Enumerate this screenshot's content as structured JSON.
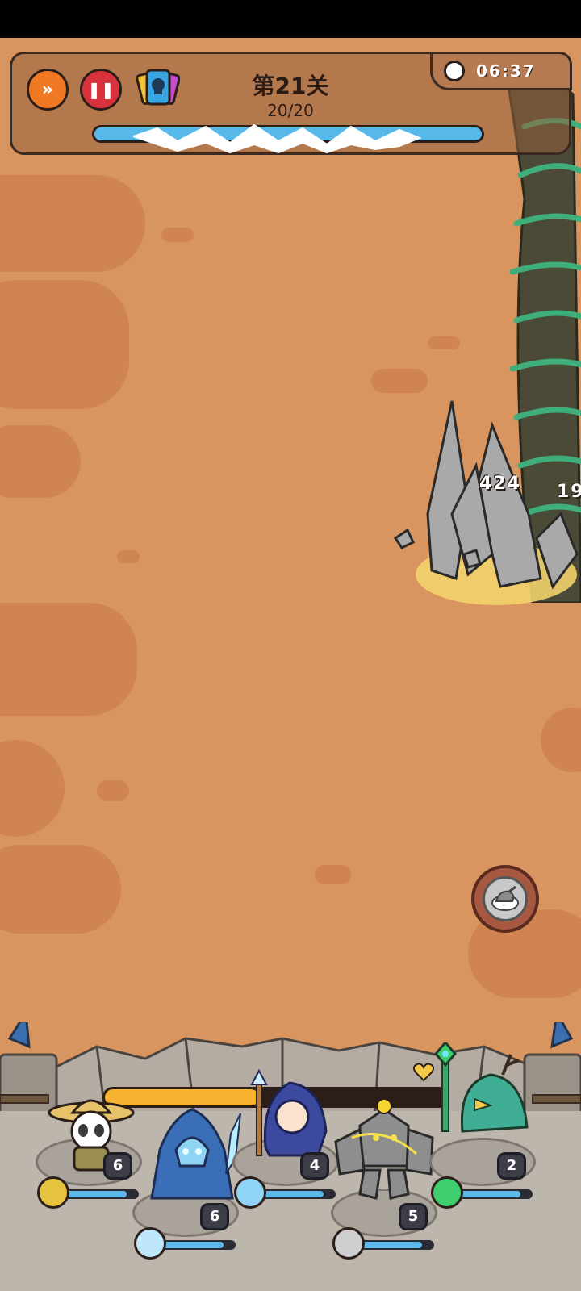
{
  "hud": {
    "level_title": "第21关",
    "wave_count": "20/20",
    "wave_progress_fraction": 1.0,
    "timer": "06:37",
    "buttons": {
      "fast_forward_icon": "double-chevron-right-icon",
      "pause_icon": "pause-icon",
      "cards_icon": "skull-card-icon"
    }
  },
  "battlefield": {
    "damage_numbers": [
      "424",
      "19"
    ],
    "skill_button_icon": "roast-meat-icon"
  },
  "base": {
    "energy_fraction": 0.45,
    "heroes": [
      {
        "name": "panda-ranger",
        "level": "6",
        "element": "lightning",
        "hp_fraction": 0.85
      },
      {
        "name": "ice-knight",
        "level": "6",
        "element": "ice",
        "hp_fraction": 0.85
      },
      {
        "name": "ice-mage",
        "level": "4",
        "element": "ice",
        "hp_fraction": 0.85
      },
      {
        "name": "stone-golem",
        "level": "5",
        "element": "rock",
        "hp_fraction": 0.85
      },
      {
        "name": "nature-bird",
        "level": "2",
        "element": "nature",
        "hp_fraction": 0.85
      }
    ]
  },
  "colors": {
    "sand": "#d99560",
    "ice": "#56b9ea",
    "energy": "#f7b22f",
    "vine": "#3fae7a"
  }
}
